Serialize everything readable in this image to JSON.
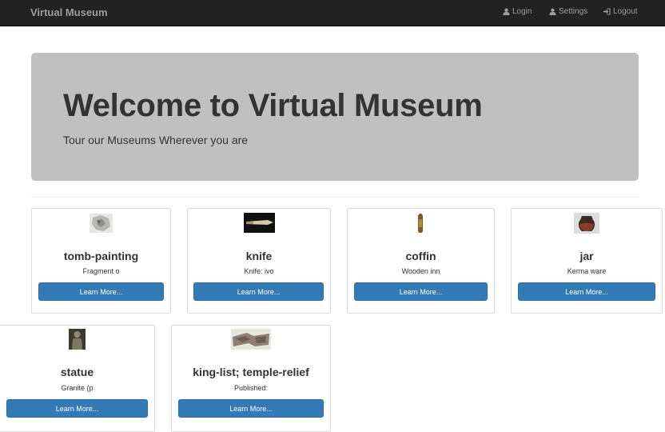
{
  "navbar": {
    "brand": "Virtual Museum",
    "links": {
      "login": "Login",
      "settings": "Settings",
      "logout": "Logout"
    }
  },
  "jumbotron": {
    "title": "Welcome to Virtual Museum",
    "subtitle": "Tour our Museums Wherever you are"
  },
  "cards": [
    {
      "title": "tomb-painting",
      "description": "Fragment o",
      "button": "Learn More...",
      "thumbnail": "tomb-painting-thumbnail"
    },
    {
      "title": "knife",
      "description": "Knife: ivo",
      "button": "Learn More...",
      "thumbnail": "knife-thumbnail"
    },
    {
      "title": "coffin",
      "description": "Wooden inn",
      "button": "Learn More...",
      "thumbnail": "coffin-thumbnail"
    },
    {
      "title": "jar",
      "description": "Kerma ware",
      "button": "Learn More...",
      "thumbnail": "jar-thumbnail"
    },
    {
      "title": "statue",
      "description": "Granite (p",
      "button": "Learn More...",
      "thumbnail": "statue-thumbnail"
    },
    {
      "title": "king-list; temple-relief",
      "description": "Published:",
      "button": "Learn More...",
      "thumbnail": "relief-thumbnail"
    }
  ],
  "colors": {
    "navbar_bg": "#222222",
    "navbar_text": "#9d9d9d",
    "jumbotron_bg": "#c0c0c0",
    "button_bg": "#337ab7"
  }
}
